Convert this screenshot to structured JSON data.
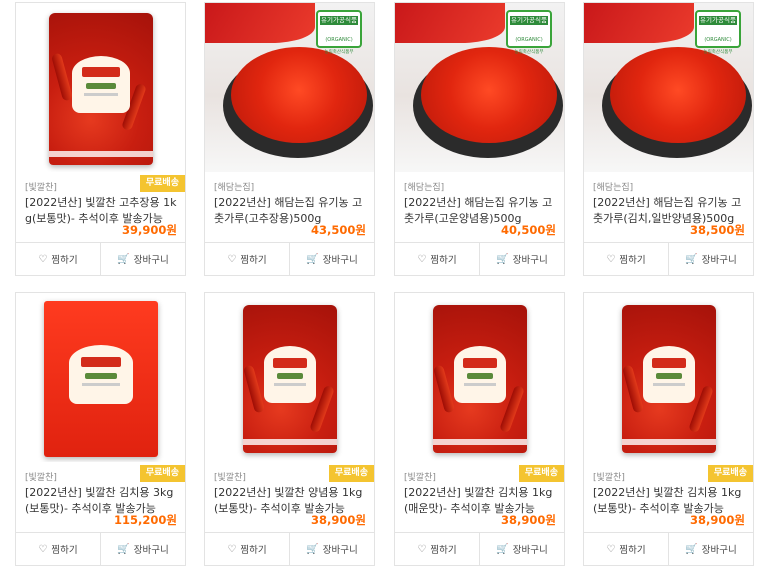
{
  "products": [
    {
      "brand": "[빛깔찬]",
      "badge": "무료배송",
      "title": "[2022년산] 빛깔찬 고추장용 1kg(보통맛)- 추석이후 발송가능",
      "price": "39,900원",
      "wish_label": "찜하기",
      "cart_label": "장바구니",
      "image": "gochugaru-bag"
    },
    {
      "brand": "[해담는집]",
      "badge": "",
      "title": "[2022년산] 해담는집 유기농 고춧가루(고추장용)500g",
      "price": "43,500원",
      "wish_label": "찜하기",
      "cart_label": "장바구니",
      "image": "organic-powder-bowl",
      "organic_label": "유기가공식품",
      "organic_sub": "(ORGANIC)",
      "organic_caption": "농림축산식품부"
    },
    {
      "brand": "[해담는집]",
      "badge": "",
      "title": "[2022년산] 해담는집 유기농 고춧가루(고운양념용)500g",
      "price": "40,500원",
      "wish_label": "찜하기",
      "cart_label": "장바구니",
      "image": "organic-powder-bowl",
      "organic_label": "유기가공식품",
      "organic_sub": "(ORGANIC)",
      "organic_caption": "농림축산식품부"
    },
    {
      "brand": "[해담는집]",
      "badge": "",
      "title": "[2022년산] 해담는집 유기농 고춧가루(김치,일반양념용)500g",
      "price": "38,500원",
      "wish_label": "찜하기",
      "cart_label": "장바구니",
      "image": "organic-powder-bowl",
      "organic_label": "유기가공식품",
      "organic_sub": "(ORGANIC)",
      "organic_caption": "농림축산식품부"
    },
    {
      "brand": "[빛깔찬]",
      "badge": "무료배송",
      "title": "[2022년산] 빛깔찬 김치용 3kg(보통맛)- 추석이후 발송가능",
      "price": "115,200원",
      "wish_label": "찜하기",
      "cart_label": "장바구니",
      "image": "gochugaru-bag-large"
    },
    {
      "brand": "[빛깔찬]",
      "badge": "무료배송",
      "title": "[2022년산] 빛깔찬 양념용 1kg(보통맛)- 추석이후 발송가능",
      "price": "38,900원",
      "wish_label": "찜하기",
      "cart_label": "장바구니",
      "image": "gochugaru-bag"
    },
    {
      "brand": "[빛깔찬]",
      "badge": "무료배송",
      "title": "[2022년산] 빛깔찬 김치용 1kg(매운맛)- 추석이후 발송가능",
      "price": "38,900원",
      "wish_label": "찜하기",
      "cart_label": "장바구니",
      "image": "gochugaru-bag"
    },
    {
      "brand": "[빛깔찬]",
      "badge": "무료배송",
      "title": "[2022년산] 빛깔찬 김치용 1kg(보통맛)- 추석이후 발송가능",
      "price": "38,900원",
      "wish_label": "찜하기",
      "cart_label": "장바구니",
      "image": "gochugaru-bag"
    }
  ],
  "colors": {
    "price": "#ff6a00",
    "badge": "#f4c430",
    "border": "#e3e3e3"
  },
  "icons": {
    "wish": "heart-icon",
    "cart": "cart-icon"
  }
}
